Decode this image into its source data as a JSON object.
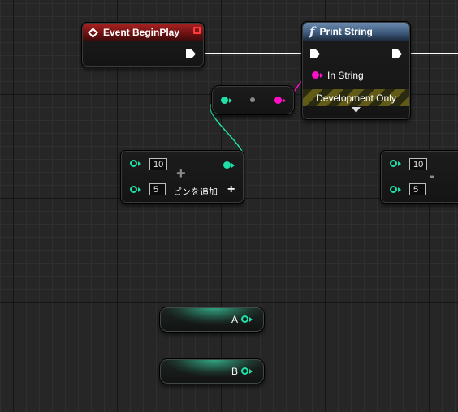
{
  "colors": {
    "exec": "#ffffff",
    "string_pin": "#ff10c8",
    "int_pin": "#1fe0a8",
    "event_header": "#a82222",
    "function_header": "#3c5878",
    "grid_bg": "#262626"
  },
  "event_node": {
    "title": "Event BeginPlay",
    "icon": "event-diamond-icon"
  },
  "print_node": {
    "title": "Print String",
    "icon": "function-f-icon",
    "input_label": "In String",
    "dev_label": "Development Only",
    "expand_icon": "expand-triangle-icon"
  },
  "add_node": {
    "a_value": "10",
    "b_value": "5",
    "add_pin_label": "ピンを追加",
    "op_symbol": "+",
    "add_pin_icon": "plus-icon"
  },
  "subtract_node": {
    "a_value": "10",
    "b_value": "5",
    "op_symbol": "-"
  },
  "variables": [
    {
      "label": "A"
    },
    {
      "label": "B"
    }
  ]
}
